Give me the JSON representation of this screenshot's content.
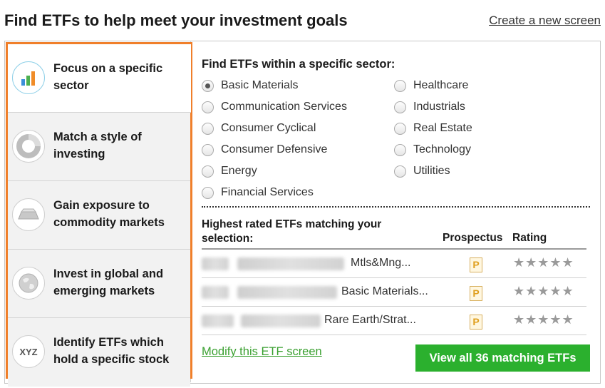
{
  "header": {
    "title": "Find ETFs to help meet your investment goals",
    "create_link": "Create a new screen"
  },
  "sidebar": {
    "items": [
      {
        "label": "Focus on a specific sector",
        "icon": "bar-chart-icon",
        "active": true
      },
      {
        "label": "Match a style of investing",
        "icon": "donut-icon",
        "active": false
      },
      {
        "label": "Gain exposure to commodity markets",
        "icon": "gold-bar-icon",
        "active": false
      },
      {
        "label": "Invest in global and emerging markets",
        "icon": "globe-icon",
        "active": false
      },
      {
        "label": "Identify ETFs which hold a specific stock",
        "icon": "xyz-icon",
        "icon_text": "XYZ",
        "active": false
      }
    ],
    "accent_color": "#f07f2a"
  },
  "sector": {
    "title": "Find ETFs within a specific sector:",
    "selected": "Basic Materials",
    "left_options": [
      "Basic Materials",
      "Communication Services",
      "Consumer Cyclical",
      "Consumer Defensive",
      "Energy",
      "Financial Services"
    ],
    "right_options": [
      "Healthcare",
      "Industrials",
      "Real Estate",
      "Technology",
      "Utilities"
    ]
  },
  "results": {
    "title": "Highest rated ETFs matching your selection:",
    "col_prospectus": "Prospectus",
    "col_rating": "Rating",
    "prospectus_icon_text": "P",
    "rows": [
      {
        "category": "Mtls&Mng...",
        "rating_stars": "★★★★★"
      },
      {
        "category": "Basic Materials...",
        "rating_stars": "★★★★★"
      },
      {
        "category": "Rare Earth/Strat...",
        "rating_stars": "★★★★★"
      }
    ]
  },
  "footer": {
    "modify_link": "Modify this ETF screen",
    "view_all_button": "View all 36 matching ETFs",
    "button_color": "#2bb02e",
    "link_color": "#3aa030"
  }
}
